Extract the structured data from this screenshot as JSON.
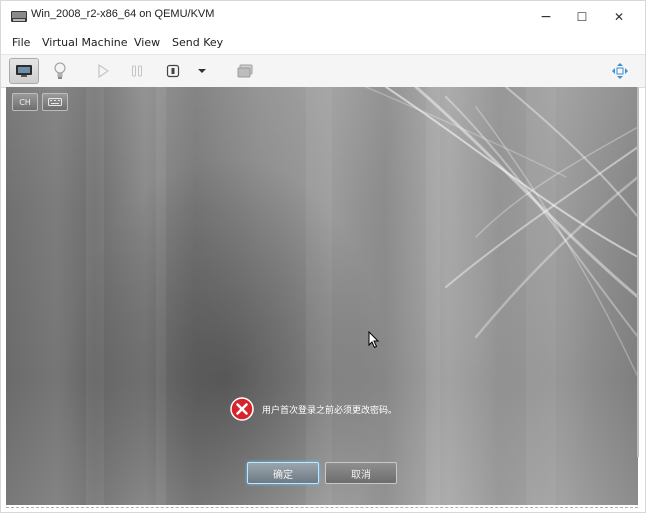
{
  "window": {
    "title": "Win_2008_r2-x86_64 on QEMU/KVM",
    "controls": {
      "minimize": "−",
      "maximize": "☐",
      "close": "✕"
    }
  },
  "menubar": {
    "items": [
      "File",
      "Virtual Machine",
      "View",
      "Send Key"
    ]
  },
  "toolbar": {
    "buttons": [
      "console-icon",
      "lightbulb-icon",
      "play-icon",
      "pause-icon",
      "power-icon",
      "dropdown-arrow-icon",
      "screenshot-icon",
      "fullscreen-icon"
    ]
  },
  "guest": {
    "ime_buttons": [
      "CH",
      "keyboard-icon"
    ],
    "error_message": "用户首次登录之前必须更改密码。",
    "ok_button": "确定",
    "cancel_button": "取消"
  },
  "colors": {
    "error_icon": "#d8232a",
    "ok_glow": "#5fc1ff"
  }
}
